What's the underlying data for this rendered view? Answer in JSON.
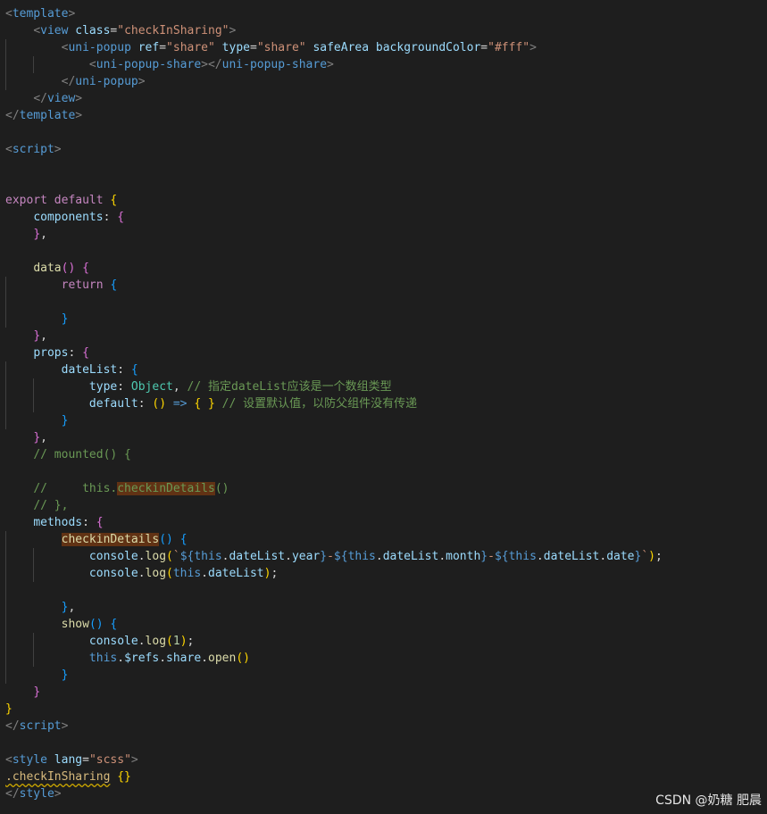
{
  "editor": {
    "lines": [
      [
        [
          "<",
          "tk-punct"
        ],
        [
          "template",
          "tk-tag"
        ],
        [
          ">",
          "tk-punct"
        ]
      ],
      [
        [
          "    "
        ],
        [
          "<",
          "tk-punct"
        ],
        [
          "view",
          "tk-tag"
        ],
        [
          " "
        ],
        [
          "class",
          "tk-attr"
        ],
        [
          "=",
          "tk-plain"
        ],
        [
          "\"checkInSharing\"",
          "tk-str"
        ],
        [
          ">",
          "tk-punct"
        ]
      ],
      [
        [
          "        "
        ],
        [
          "<",
          "tk-punct"
        ],
        [
          "uni-popup",
          "tk-tag"
        ],
        [
          " "
        ],
        [
          "ref",
          "tk-attr"
        ],
        [
          "=",
          "tk-plain"
        ],
        [
          "\"share\"",
          "tk-str"
        ],
        [
          " "
        ],
        [
          "type",
          "tk-attr"
        ],
        [
          "=",
          "tk-plain"
        ],
        [
          "\"share\"",
          "tk-str"
        ],
        [
          " "
        ],
        [
          "safeArea",
          "tk-attr"
        ],
        [
          " "
        ],
        [
          "backgroundColor",
          "tk-attr"
        ],
        [
          "=",
          "tk-plain"
        ],
        [
          "\"#fff\"",
          "tk-str"
        ],
        [
          ">",
          "tk-punct"
        ]
      ],
      [
        [
          "            "
        ],
        [
          "<",
          "tk-punct"
        ],
        [
          "uni-popup-share",
          "tk-tag"
        ],
        [
          "></",
          "tk-punct"
        ],
        [
          "uni-popup-share",
          "tk-tag"
        ],
        [
          ">",
          "tk-punct"
        ]
      ],
      [
        [
          "        "
        ],
        [
          "</",
          "tk-punct"
        ],
        [
          "uni-popup",
          "tk-tag"
        ],
        [
          ">",
          "tk-punct"
        ]
      ],
      [
        [
          "    "
        ],
        [
          "</",
          "tk-punct"
        ],
        [
          "view",
          "tk-tag"
        ],
        [
          ">",
          "tk-punct"
        ]
      ],
      [
        [
          "</",
          "tk-punct"
        ],
        [
          "template",
          "tk-tag"
        ],
        [
          ">",
          "tk-punct"
        ]
      ],
      [],
      [
        [
          "<",
          "tk-punct"
        ],
        [
          "script",
          "tk-tag"
        ],
        [
          ">",
          "tk-punct"
        ]
      ],
      [],
      [],
      [
        [
          "export",
          "tk-ctrl"
        ],
        [
          " "
        ],
        [
          "default",
          "tk-ctrl"
        ],
        [
          " "
        ],
        [
          "{",
          "tk-b1"
        ]
      ],
      [
        [
          "    "
        ],
        [
          "components",
          "tk-prop"
        ],
        [
          ": ",
          "tk-plain"
        ],
        [
          "{",
          "tk-b2"
        ]
      ],
      [
        [
          "    "
        ],
        [
          "}",
          "tk-b2"
        ],
        [
          ",",
          "tk-plain"
        ]
      ],
      [],
      [
        [
          "    "
        ],
        [
          "data",
          "tk-fn"
        ],
        [
          "()",
          "tk-b2"
        ],
        [
          " "
        ],
        [
          "{",
          "tk-b2"
        ]
      ],
      [
        [
          "        "
        ],
        [
          "return",
          "tk-ctrl"
        ],
        [
          " "
        ],
        [
          "{",
          "tk-b3"
        ]
      ],
      [],
      [
        [
          "        "
        ],
        [
          "}",
          "tk-b3"
        ]
      ],
      [
        [
          "    "
        ],
        [
          "}",
          "tk-b2"
        ],
        [
          ",",
          "tk-plain"
        ]
      ],
      [
        [
          "    "
        ],
        [
          "props",
          "tk-prop"
        ],
        [
          ": ",
          "tk-plain"
        ],
        [
          "{",
          "tk-b2"
        ]
      ],
      [
        [
          "        "
        ],
        [
          "dateList",
          "tk-prop"
        ],
        [
          ": ",
          "tk-plain"
        ],
        [
          "{",
          "tk-b3"
        ]
      ],
      [
        [
          "            "
        ],
        [
          "type",
          "tk-prop"
        ],
        [
          ": ",
          "tk-plain"
        ],
        [
          "Object",
          "tk-type"
        ],
        [
          ", ",
          "tk-plain"
        ],
        [
          "// 指定dateList应该是一个数组类型",
          "tk-cmt"
        ]
      ],
      [
        [
          "            "
        ],
        [
          "default",
          "tk-prop"
        ],
        [
          ": ",
          "tk-plain"
        ],
        [
          "()",
          "tk-b1"
        ],
        [
          " "
        ],
        [
          "=>",
          "tk-kw"
        ],
        [
          " "
        ],
        [
          "{",
          "tk-b1"
        ],
        [
          " "
        ],
        [
          "}",
          "tk-b1"
        ],
        [
          " "
        ],
        [
          "// 设置默认值，以防父组件没有传递",
          "tk-cmt"
        ]
      ],
      [
        [
          "        "
        ],
        [
          "}",
          "tk-b3"
        ]
      ],
      [
        [
          "    "
        ],
        [
          "}",
          "tk-b2"
        ],
        [
          ",",
          "tk-plain"
        ]
      ],
      [
        [
          "    "
        ],
        [
          "// mounted() {",
          "tk-cmt"
        ]
      ],
      [],
      [
        [
          "    "
        ],
        [
          "//     this.",
          "tk-cmt"
        ],
        [
          "checkinDetails",
          "tk-cmt hl"
        ],
        [
          "()",
          "tk-cmt"
        ]
      ],
      [
        [
          "    "
        ],
        [
          "// },",
          "tk-cmt"
        ]
      ],
      [
        [
          "    "
        ],
        [
          "methods",
          "tk-prop"
        ],
        [
          ": ",
          "tk-plain"
        ],
        [
          "{",
          "tk-b2"
        ]
      ],
      [
        [
          "        "
        ],
        [
          "checkinDetails",
          "tk-fn hl"
        ],
        [
          "()",
          "tk-b3"
        ],
        [
          " "
        ],
        [
          "{",
          "tk-b3"
        ]
      ],
      [
        [
          "            "
        ],
        [
          "console",
          "tk-prop"
        ],
        [
          ".",
          "tk-plain"
        ],
        [
          "log",
          "tk-fn"
        ],
        [
          "(",
          "tk-b1"
        ],
        [
          "`",
          "tk-str"
        ],
        [
          "${",
          "tk-kw"
        ],
        [
          "this",
          "tk-kw"
        ],
        [
          ".",
          "tk-plain"
        ],
        [
          "dateList",
          "tk-prop"
        ],
        [
          ".",
          "tk-plain"
        ],
        [
          "year",
          "tk-prop"
        ],
        [
          "}",
          "tk-kw"
        ],
        [
          "-",
          "tk-str"
        ],
        [
          "${",
          "tk-kw"
        ],
        [
          "this",
          "tk-kw"
        ],
        [
          ".",
          "tk-plain"
        ],
        [
          "dateList",
          "tk-prop"
        ],
        [
          ".",
          "tk-plain"
        ],
        [
          "month",
          "tk-prop"
        ],
        [
          "}",
          "tk-kw"
        ],
        [
          "-",
          "tk-str"
        ],
        [
          "${",
          "tk-kw"
        ],
        [
          "this",
          "tk-kw"
        ],
        [
          ".",
          "tk-plain"
        ],
        [
          "dateList",
          "tk-prop"
        ],
        [
          ".",
          "tk-plain"
        ],
        [
          "date",
          "tk-prop"
        ],
        [
          "}",
          "tk-kw"
        ],
        [
          "`",
          "tk-str"
        ],
        [
          ")",
          "tk-b1"
        ],
        [
          ";",
          "tk-plain"
        ]
      ],
      [
        [
          "            "
        ],
        [
          "console",
          "tk-prop"
        ],
        [
          ".",
          "tk-plain"
        ],
        [
          "log",
          "tk-fn"
        ],
        [
          "(",
          "tk-b1"
        ],
        [
          "this",
          "tk-kw"
        ],
        [
          ".",
          "tk-plain"
        ],
        [
          "dateList",
          "tk-prop"
        ],
        [
          ")",
          "tk-b1"
        ],
        [
          ";",
          "tk-plain"
        ]
      ],
      [],
      [
        [
          "        "
        ],
        [
          "}",
          "tk-b3"
        ],
        [
          ",",
          "tk-plain"
        ]
      ],
      [
        [
          "        "
        ],
        [
          "show",
          "tk-fn"
        ],
        [
          "()",
          "tk-b3"
        ],
        [
          " "
        ],
        [
          "{",
          "tk-b3"
        ]
      ],
      [
        [
          "            "
        ],
        [
          "console",
          "tk-prop"
        ],
        [
          ".",
          "tk-plain"
        ],
        [
          "log",
          "tk-fn"
        ],
        [
          "(",
          "tk-b1"
        ],
        [
          "1",
          "tk-num"
        ],
        [
          ")",
          "tk-b1"
        ],
        [
          ";",
          "tk-plain"
        ]
      ],
      [
        [
          "            "
        ],
        [
          "this",
          "tk-kw"
        ],
        [
          ".",
          "tk-plain"
        ],
        [
          "$refs",
          "tk-prop"
        ],
        [
          ".",
          "tk-plain"
        ],
        [
          "share",
          "tk-prop"
        ],
        [
          ".",
          "tk-plain"
        ],
        [
          "open",
          "tk-fn"
        ],
        [
          "()",
          "tk-b1"
        ]
      ],
      [
        [
          "        "
        ],
        [
          "}",
          "tk-b3"
        ]
      ],
      [
        [
          "    "
        ],
        [
          "}",
          "tk-b2"
        ]
      ],
      [
        [
          "}",
          "tk-b1"
        ]
      ],
      [
        [
          "</",
          "tk-punct"
        ],
        [
          "script",
          "tk-tag"
        ],
        [
          ">",
          "tk-punct"
        ]
      ],
      [],
      [
        [
          "<",
          "tk-punct"
        ],
        [
          "style",
          "tk-tag"
        ],
        [
          " "
        ],
        [
          "lang",
          "tk-attr"
        ],
        [
          "=",
          "tk-plain"
        ],
        [
          "\"scss\"",
          "tk-str"
        ],
        [
          ">",
          "tk-punct"
        ]
      ],
      [
        [
          ".checkInSharing",
          "tk-sel squig"
        ],
        [
          " "
        ],
        [
          "{}",
          "tk-b1"
        ]
      ],
      [
        [
          "</",
          "tk-punct"
        ],
        [
          "style",
          "tk-tag"
        ],
        [
          ">",
          "tk-punct"
        ]
      ]
    ]
  },
  "watermark": {
    "text": "CSDN @奶糖 肥晨"
  }
}
